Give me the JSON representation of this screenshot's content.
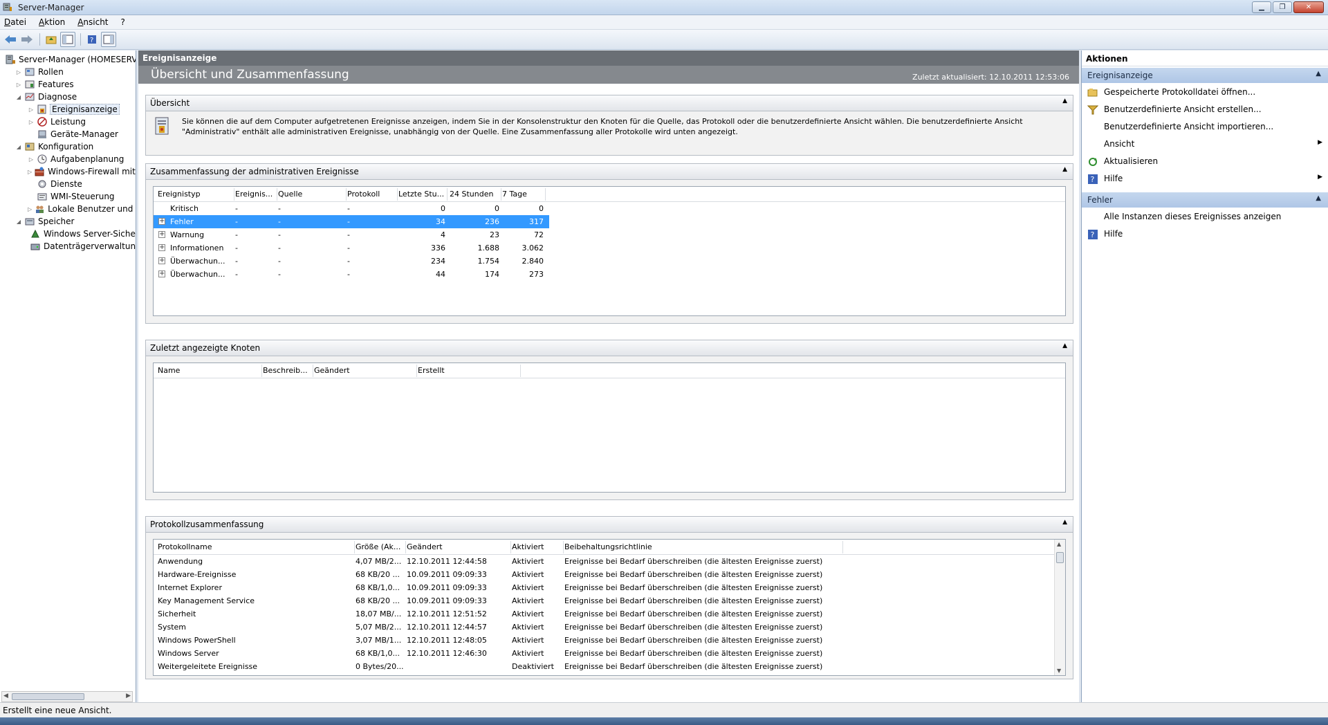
{
  "window": {
    "title": "Server-Manager"
  },
  "menu": [
    "Datei",
    "Aktion",
    "Ansicht",
    "?"
  ],
  "tree": [
    {
      "label": "Server-Manager (HOMESERVER)",
      "level": 0,
      "exp": "",
      "icon": "server-icon"
    },
    {
      "label": "Rollen",
      "level": 1,
      "exp": "▷",
      "icon": "roles-icon"
    },
    {
      "label": "Features",
      "level": 1,
      "exp": "▷",
      "icon": "features-icon"
    },
    {
      "label": "Diagnose",
      "level": 1,
      "exp": "◢",
      "icon": "diagnose-icon"
    },
    {
      "label": "Ereignisanzeige",
      "level": 2,
      "exp": "▷",
      "icon": "event-viewer-icon",
      "selected": true
    },
    {
      "label": "Leistung",
      "level": 2,
      "exp": "▷",
      "icon": "performance-icon"
    },
    {
      "label": "Geräte-Manager",
      "level": 2,
      "exp": "",
      "icon": "device-manager-icon"
    },
    {
      "label": "Konfiguration",
      "level": 1,
      "exp": "◢",
      "icon": "configuration-icon"
    },
    {
      "label": "Aufgabenplanung",
      "level": 2,
      "exp": "▷",
      "icon": "task-scheduler-icon"
    },
    {
      "label": "Windows-Firewall mit er",
      "level": 2,
      "exp": "▷",
      "icon": "firewall-icon"
    },
    {
      "label": "Dienste",
      "level": 2,
      "exp": "",
      "icon": "services-icon"
    },
    {
      "label": "WMI-Steuerung",
      "level": 2,
      "exp": "",
      "icon": "wmi-icon"
    },
    {
      "label": "Lokale Benutzer und Gru",
      "level": 2,
      "exp": "▷",
      "icon": "users-icon"
    },
    {
      "label": "Speicher",
      "level": 1,
      "exp": "◢",
      "icon": "storage-icon"
    },
    {
      "label": "Windows Server-Sicherur",
      "level": 2,
      "exp": "",
      "icon": "backup-icon"
    },
    {
      "label": "Datenträgerverwaltung",
      "level": 2,
      "exp": "",
      "icon": "disk-management-icon"
    }
  ],
  "center": {
    "header": "Ereignisanzeige",
    "title": "Übersicht und Zusammenfassung",
    "updated": "Zuletzt aktualisiert: 12.10.2011 12:53:06",
    "overview": {
      "title": "Übersicht",
      "text": "Sie können die auf dem Computer aufgetretenen Ereignisse anzeigen, indem Sie in der Konsolenstruktur den Knoten für die Quelle, das Protokoll oder die benutzerdefinierte Ansicht wählen. Die benutzerdefinierte Ansicht \"Administrativ\" enthält alle administrativen Ereignisse, unabhängig von der Quelle. Eine Zusammenfassung aller Protokolle wird unten angezeigt."
    },
    "summary": {
      "title": "Zusammenfassung der administrativen Ereignisse",
      "columns": [
        "Ereignistyp",
        "Ereignis...",
        "Quelle",
        "Protokoll",
        "Letzte Stu...",
        "24 Stunden",
        "7 Tage"
      ],
      "rows": [
        {
          "type": "Kritisch",
          "id": "-",
          "source": "-",
          "log": "-",
          "hour": "0",
          "day": "0",
          "week": "0",
          "plus": false
        },
        {
          "type": "Fehler",
          "id": "-",
          "source": "-",
          "log": "-",
          "hour": "34",
          "day": "236",
          "week": "317",
          "plus": true,
          "selected": true
        },
        {
          "type": "Warnung",
          "id": "-",
          "source": "-",
          "log": "-",
          "hour": "4",
          "day": "23",
          "week": "72",
          "plus": true
        },
        {
          "type": "Informationen",
          "id": "-",
          "source": "-",
          "log": "-",
          "hour": "336",
          "day": "1.688",
          "week": "3.062",
          "plus": true
        },
        {
          "type": "Überwachun...",
          "id": "-",
          "source": "-",
          "log": "-",
          "hour": "234",
          "day": "1.754",
          "week": "2.840",
          "plus": true
        },
        {
          "type": "Überwachun...",
          "id": "-",
          "source": "-",
          "log": "-",
          "hour": "44",
          "day": "174",
          "week": "273",
          "plus": true
        }
      ]
    },
    "recent": {
      "title": "Zuletzt angezeigte Knoten",
      "columns": [
        "Name",
        "Beschreib...",
        "Geändert",
        "Erstellt"
      ]
    },
    "logs": {
      "title": "Protokollzusammenfassung",
      "columns": [
        "Protokollname",
        "Größe (Ak...",
        "Geändert",
        "Aktiviert",
        "Beibehaltungsrichtlinie"
      ],
      "rows": [
        {
          "name": "Anwendung",
          "size": "4,07 MB/2...",
          "changed": "12.10.2011 12:44:58",
          "enabled": "Aktiviert",
          "policy": "Ereignisse bei Bedarf überschreiben (die ältesten Ereignisse zuerst)"
        },
        {
          "name": "Hardware-Ereignisse",
          "size": "68 KB/20 ...",
          "changed": "10.09.2011 09:09:33",
          "enabled": "Aktiviert",
          "policy": "Ereignisse bei Bedarf überschreiben (die ältesten Ereignisse zuerst)"
        },
        {
          "name": "Internet Explorer",
          "size": "68 KB/1,0...",
          "changed": "10.09.2011 09:09:33",
          "enabled": "Aktiviert",
          "policy": "Ereignisse bei Bedarf überschreiben (die ältesten Ereignisse zuerst)"
        },
        {
          "name": "Key Management Service",
          "size": "68 KB/20 ...",
          "changed": "10.09.2011 09:09:33",
          "enabled": "Aktiviert",
          "policy": "Ereignisse bei Bedarf überschreiben (die ältesten Ereignisse zuerst)"
        },
        {
          "name": "Sicherheit",
          "size": "18,07 MB/...",
          "changed": "12.10.2011 12:51:52",
          "enabled": "Aktiviert",
          "policy": "Ereignisse bei Bedarf überschreiben (die ältesten Ereignisse zuerst)"
        },
        {
          "name": "System",
          "size": "5,07 MB/2...",
          "changed": "12.10.2011 12:44:57",
          "enabled": "Aktiviert",
          "policy": "Ereignisse bei Bedarf überschreiben (die ältesten Ereignisse zuerst)"
        },
        {
          "name": "Windows PowerShell",
          "size": "3,07 MB/1...",
          "changed": "12.10.2011 12:48:05",
          "enabled": "Aktiviert",
          "policy": "Ereignisse bei Bedarf überschreiben (die ältesten Ereignisse zuerst)"
        },
        {
          "name": "Windows Server",
          "size": "68 KB/1,0...",
          "changed": "12.10.2011 12:46:30",
          "enabled": "Aktiviert",
          "policy": "Ereignisse bei Bedarf überschreiben (die ältesten Ereignisse zuerst)"
        },
        {
          "name": "Weitergeleitete Ereignisse",
          "size": "0 Bytes/20...",
          "changed": "",
          "enabled": "Deaktiviert",
          "policy": "Ereignisse bei Bedarf überschreiben (die ältesten Ereignisse zuerst)"
        }
      ]
    }
  },
  "actions": {
    "title": "Aktionen",
    "groups": [
      {
        "title": "Ereignisanzeige",
        "items": [
          {
            "label": "Gespeicherte Protokolldatei öffnen...",
            "icon": "open-folder-icon",
            "arrow": false
          },
          {
            "label": "Benutzerdefinierte Ansicht erstellen...",
            "icon": "filter-icon",
            "arrow": false
          },
          {
            "label": "Benutzerdefinierte Ansicht importieren...",
            "icon": "",
            "arrow": false
          },
          {
            "label": "Ansicht",
            "icon": "",
            "arrow": true
          },
          {
            "label": "Aktualisieren",
            "icon": "refresh-icon",
            "arrow": false
          },
          {
            "label": "Hilfe",
            "icon": "help-icon",
            "arrow": true
          }
        ]
      },
      {
        "title": "Fehler",
        "items": [
          {
            "label": "Alle Instanzen dieses Ereignisses anzeigen",
            "icon": "",
            "arrow": false
          },
          {
            "label": "Hilfe",
            "icon": "help-icon",
            "arrow": false
          }
        ]
      }
    ]
  },
  "status": "Erstellt eine neue Ansicht.",
  "colors": {
    "selection": "#3399ff",
    "header_dark": "#6a6f75",
    "header_mid": "#85898e",
    "action_group": "#b9cfea"
  }
}
